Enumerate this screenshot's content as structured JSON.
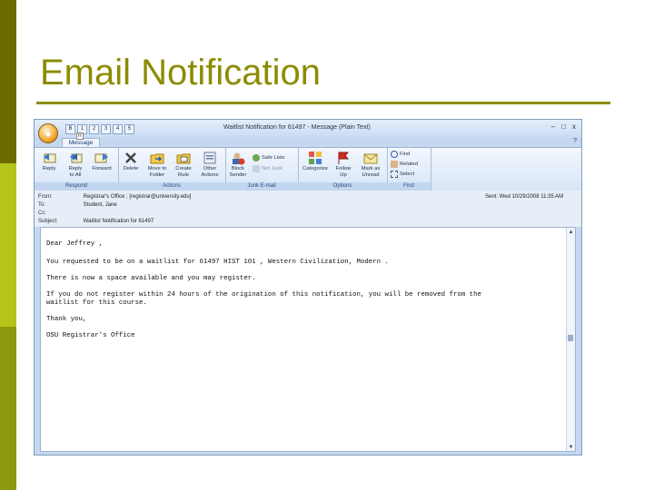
{
  "slide": {
    "title": "Email Notification",
    "colors": {
      "title": "#8c8c00",
      "bar_dark": "#6b6b00",
      "bar_light": "#b5c41a"
    }
  },
  "window": {
    "title": "Waitlist Notification for 61497 - Message (Plain Text)",
    "quick_access": [
      "B",
      "1",
      "2",
      "3",
      "4",
      "5"
    ],
    "controls": {
      "minimize": "–",
      "maximize": "□",
      "close": "x"
    },
    "tab": "Message",
    "tab_key": "H",
    "help": "?"
  },
  "ribbon": {
    "groups": [
      {
        "label": "Respond",
        "buttons": [
          "Reply",
          "Reply\nto All",
          "Forward"
        ]
      },
      {
        "label": "Actions",
        "buttons": [
          "Delete",
          "Move to\nFolder",
          "Create\nRule",
          "Other\nActions"
        ]
      },
      {
        "label": "Junk E-mail",
        "buttons": [
          "Block\nSender"
        ],
        "small": [
          "Safe Lists",
          "Not Junk"
        ]
      },
      {
        "label": "Options",
        "buttons": [
          "Categorize",
          "Follow\nUp",
          "Mark as\nUnread"
        ]
      },
      {
        "label": "Find",
        "small": [
          "Find",
          "Related",
          "Select"
        ]
      }
    ]
  },
  "header": {
    "from_label": "From:",
    "from_value": "Registrar's Office ; [registrar@university.edu]",
    "to_label": "To:",
    "to_value": "Student, Jane",
    "cc_label": "Cc:",
    "cc_value": "",
    "subject_label": "Subject:",
    "subject_value": "Waitlist Notification for 61497",
    "sent": "Sent: Wed 10/29/2008 11:35 AM"
  },
  "body": {
    "greeting": "Dear Jeffrey ,",
    "line1": "You requested to be on a waitlist for 61497 HIST 101 , Western Civilization, Modern .",
    "line2": "There is now a space available and you may register.",
    "line3a": "If you do not register within 24 hours of the origination of this notification, you will be removed from the",
    "line3b": "waitlist for this course.",
    "thanks": "Thank you,",
    "signature": "OSU Registrar's Office"
  }
}
